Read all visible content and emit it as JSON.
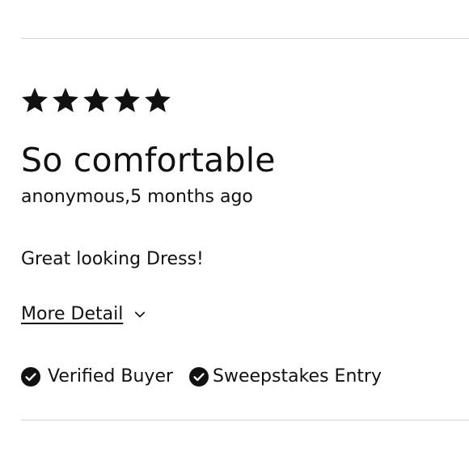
{
  "review": {
    "rating": 5,
    "rating_max": 5,
    "title": "So comfortable",
    "author_meta": "anonymous,5 months ago",
    "body": "Great looking Dress!",
    "more_detail_label": "More Detail",
    "badges": [
      {
        "label": "Verified Buyer",
        "icon": "check-circle-icon"
      },
      {
        "label": "Sweepstakes Entry",
        "icon": "check-circle-icon"
      }
    ]
  },
  "colors": {
    "text": "#111111",
    "divider": "#d6d6d6",
    "background": "#ffffff"
  }
}
